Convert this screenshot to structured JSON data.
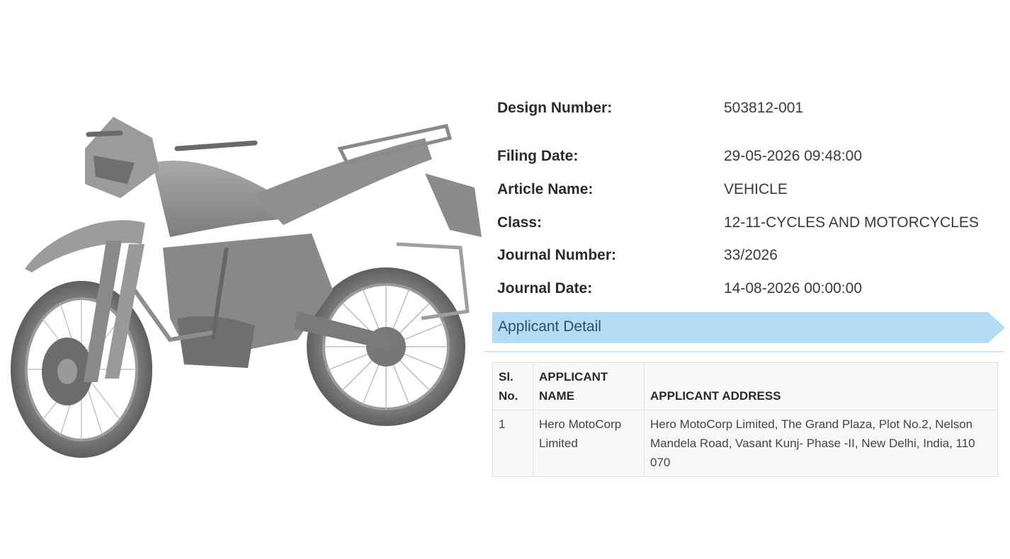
{
  "fields": [
    {
      "label": "Design Number:",
      "value": "503812-001"
    },
    {
      "label": "Filing Date:",
      "value": "29-05-2026 09:48:00"
    },
    {
      "label": "Article Name:",
      "value": "VEHICLE"
    },
    {
      "label": "Class:",
      "value": "12-11-CYCLES AND MOTORCYCLES"
    },
    {
      "label": "Journal Number:",
      "value": "33/2026"
    },
    {
      "label": "Journal Date:",
      "value": "14-08-2026 00:00:00"
    }
  ],
  "applicant_section": {
    "title": "Applicant Detail",
    "banner_color": "#b3dbf4",
    "headers": {
      "sl_line1": "Sl.",
      "sl_line2": "No.",
      "name_line1": "APPLICANT",
      "name_line2": "NAME",
      "address": "APPLICANT ADDRESS"
    },
    "rows": [
      {
        "sl": "1",
        "name": "Hero MotoCorp Limited",
        "address": "Hero MotoCorp Limited, The Grand Plaza, Plot No.2, Nelson Mandela Road, Vasant Kunj- Phase -II, New Delhi, India, 110 070"
      }
    ]
  },
  "figure": {
    "subject": "motorcycle-design-drawing",
    "tone": "grayscale"
  }
}
